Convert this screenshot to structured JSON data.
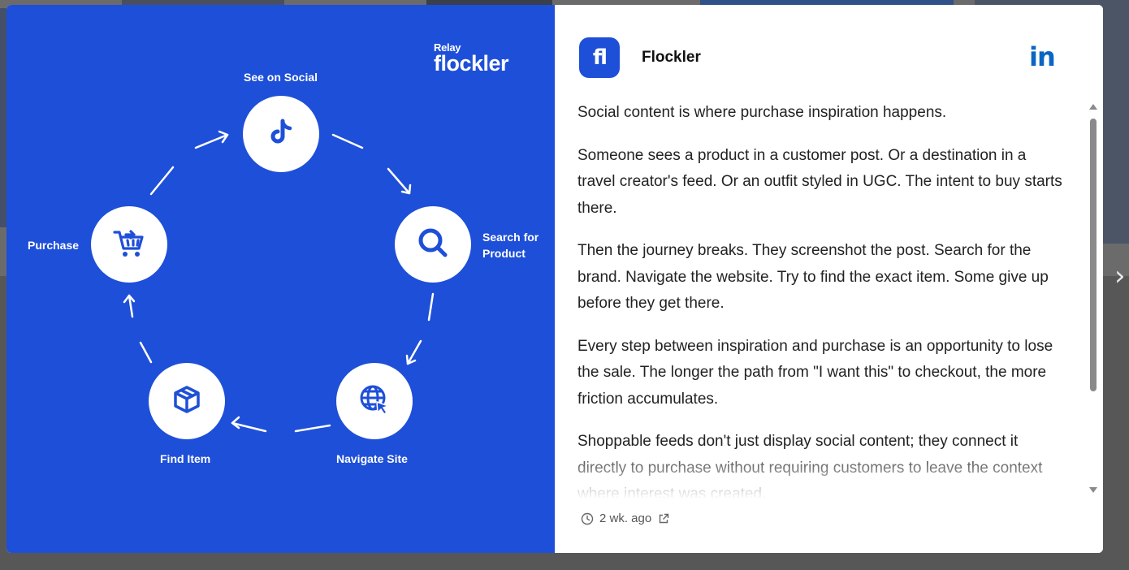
{
  "background": {
    "next_glyph": "›"
  },
  "media": {
    "brand_relay": "Relay",
    "brand_name": "flockler",
    "accent": "#1e4fd8",
    "steps": [
      {
        "label": "See on Social",
        "icon": "tiktok-icon"
      },
      {
        "label_line1": "Search for",
        "label_line2": "Product",
        "icon": "search-icon"
      },
      {
        "label": "Navigate Site",
        "icon": "globe-cursor-icon"
      },
      {
        "label": "Find Item",
        "icon": "box-icon"
      },
      {
        "label": "Purchase",
        "icon": "cart-icon"
      }
    ]
  },
  "post": {
    "avatar_text": "fl",
    "author": "Flockler",
    "network_icon": "linkedin-icon",
    "network_glyph": "in",
    "network_color": "#0a66c2",
    "paragraphs": [
      "Social content is where purchase inspiration happens.",
      "Someone sees a product in a customer post. Or a destination in a travel creator's feed. Or an outfit styled in UGC. The intent to buy starts there.",
      "Then the journey breaks. They screenshot the post. Search for the brand. Navigate the website. Try to find the exact item. Some give up before they get there.",
      "Every step between inspiration and purchase is an opportunity to lose the sale. The longer the path from \"I want this\" to checkout, the more friction accumulates.",
      "Shoppable feeds don't just display social content; they connect it directly to purchase without requiring customers to leave the context where interest was created."
    ],
    "timestamp": "2 wk. ago"
  }
}
